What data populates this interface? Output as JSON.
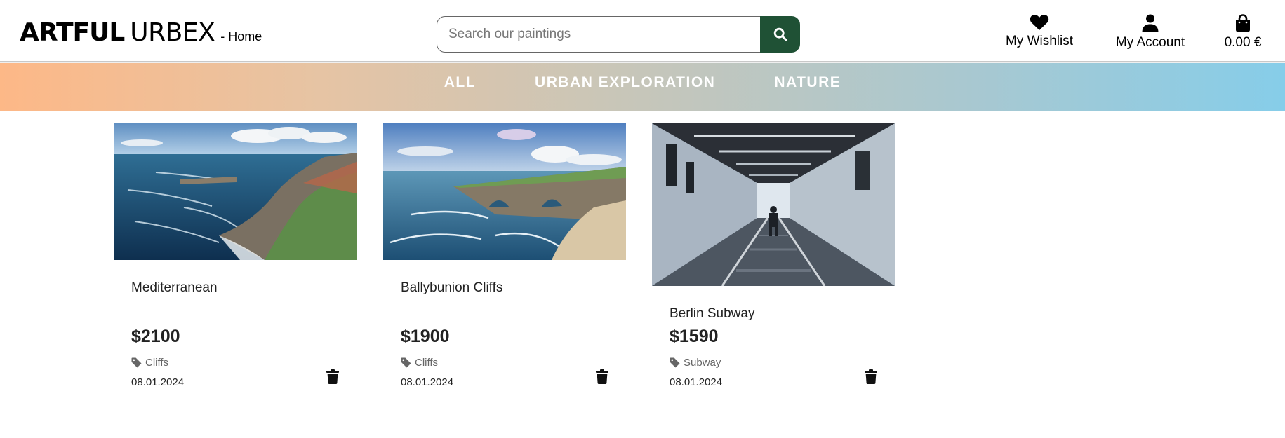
{
  "header": {
    "logo_bold": "ARTFUL",
    "logo_light": "URBEX",
    "logo_sub": "- Home",
    "search_placeholder": "Search our paintings",
    "wishlist_label": "My Wishlist",
    "account_label": "My Account",
    "cart_total": "0.00 €"
  },
  "categories": [
    "ALL",
    "URBAN EXPLORATION",
    "NATURE"
  ],
  "products": [
    {
      "title": "Mediterranean",
      "price": "$2100",
      "tag": "Cliffs",
      "date": "08.01.2024"
    },
    {
      "title": "Ballybunion Cliffs",
      "price": "$1900",
      "tag": "Cliffs",
      "date": "08.01.2024"
    },
    {
      "title": "Berlin Subway",
      "price": "$1590",
      "tag": "Subway",
      "date": "08.01.2024"
    }
  ],
  "colors": {
    "search_button": "#1f5135",
    "gradient_left": "#fdb887",
    "gradient_right": "#86cde9"
  },
  "icons": {
    "search": "search-icon",
    "wishlist": "heart-icon",
    "account": "user-icon",
    "cart": "shopping-bag-icon",
    "tag": "tag-icon",
    "delete": "trash-icon"
  }
}
